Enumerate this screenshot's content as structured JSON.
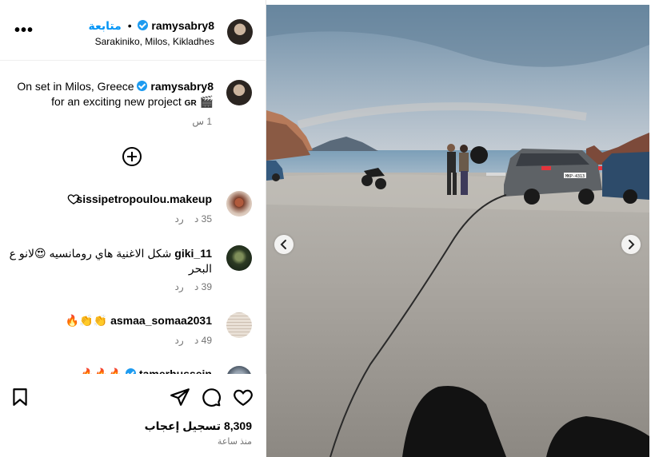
{
  "header": {
    "username": "ramysabry8",
    "separator": "•",
    "follow_label": "متابعة",
    "location": "Sarakiniko, Milos, Kikladhes"
  },
  "caption": {
    "username": "ramysabry8",
    "text_line1": "On set in Milos, Greece",
    "text_line2": "for an exciting new project",
    "flag_text": "GR",
    "emoji": "🎬",
    "time": "1 س"
  },
  "comments": [
    {
      "username": "sissipetropoulou.makeup",
      "text": "",
      "time": "35 د",
      "reply_label": "رد"
    },
    {
      "username": "giki_11",
      "text": "شكل الاغنية هاي رومانسيه 😍لانو ع البحر",
      "time": "39 د",
      "reply_label": "رد"
    },
    {
      "username": "asmaa_somaa2031",
      "text": "👏👏🔥",
      "time": "49 د",
      "reply_label": "رد"
    },
    {
      "username": "tamerhussein",
      "text": "🔥🔥🔥",
      "time": "",
      "reply_label": ""
    }
  ],
  "actions": {
    "likes_count": "8,309",
    "likes_label": "تسجيل إعجاب",
    "posted_ago": "منذ ساعة"
  },
  "photo": {
    "plate_text": "ΜΚΡ-4313"
  },
  "icons": [
    "more-icon",
    "verified-icon",
    "add-comment-icon",
    "heart-icon",
    "comment-icon",
    "share-icon",
    "bookmark-icon",
    "chevron-left-icon",
    "chevron-right-icon"
  ],
  "colors": {
    "follow": "#0095f6",
    "verified": "#1d9bf0",
    "meta": "#737373"
  }
}
